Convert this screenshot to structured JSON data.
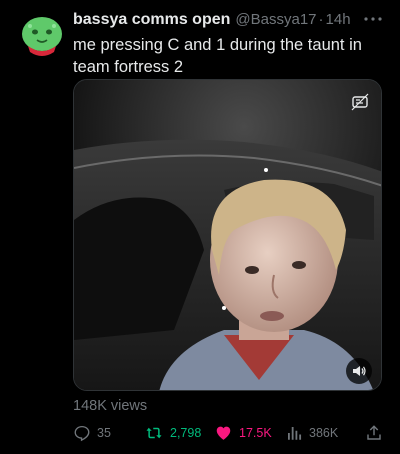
{
  "tweet": {
    "author_name": "bassya comms open",
    "handle": "@Bassya17",
    "separator": "·",
    "time": "14h",
    "text": "me pressing C and 1 during the taunt in team fortress 2",
    "views_line": "148K views"
  },
  "actions": {
    "replies": "35",
    "retweets": "2,798",
    "likes": "17.5K",
    "views": "386K"
  },
  "colors": {
    "background": "#000000",
    "text": "#e7e9ea",
    "muted": "#71767b",
    "retweet_green": "#00ba7c",
    "like_pink": "#f91880",
    "avatar_green": "#5fc96a"
  },
  "icons": {
    "more": "more-icon",
    "reply": "reply-icon",
    "retweet": "retweet-icon",
    "like": "heart-filled-icon",
    "views": "views-icon",
    "share": "share-icon",
    "sound": "sound-icon",
    "media_badge": "media-badge-icon"
  }
}
